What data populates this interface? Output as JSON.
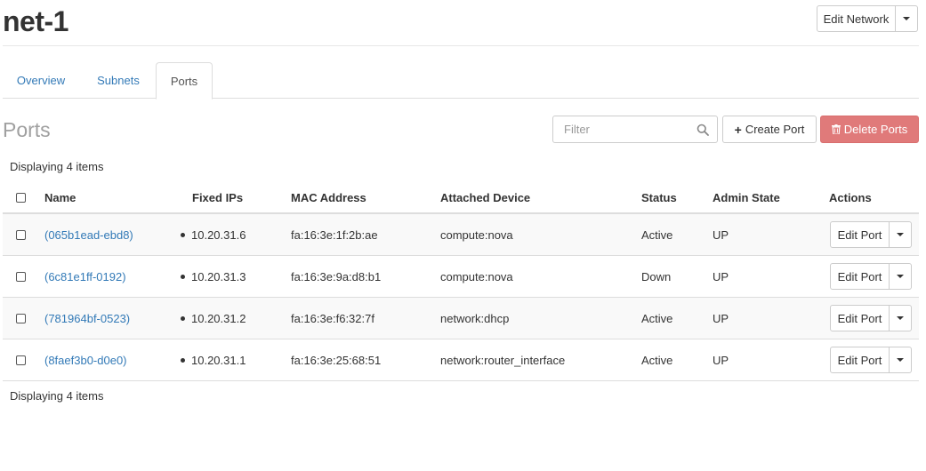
{
  "header": {
    "title": "net-1",
    "edit_network_label": "Edit Network"
  },
  "tabs": [
    {
      "label": "Overview"
    },
    {
      "label": "Subnets"
    },
    {
      "label": "Ports"
    }
  ],
  "ports_section": {
    "title": "Ports",
    "filter_placeholder": "Filter",
    "create_label": "Create Port",
    "delete_label": "Delete Ports",
    "count_text": "Displaying 4 items",
    "columns": [
      "Name",
      "Fixed IPs",
      "MAC Address",
      "Attached Device",
      "Status",
      "Admin State",
      "Actions"
    ],
    "rows": [
      {
        "name": "(065b1ead-ebd8)",
        "ip": "10.20.31.6",
        "mac": "fa:16:3e:1f:2b:ae",
        "device": "compute:nova",
        "status": "Active",
        "admin_state": "UP",
        "action": "Edit Port"
      },
      {
        "name": "(6c81e1ff-0192)",
        "ip": "10.20.31.3",
        "mac": "fa:16:3e:9a:d8:b1",
        "device": "compute:nova",
        "status": "Down",
        "admin_state": "UP",
        "action": "Edit Port"
      },
      {
        "name": "(781964bf-0523)",
        "ip": "10.20.31.2",
        "mac": "fa:16:3e:f6:32:7f",
        "device": "network:dhcp",
        "status": "Active",
        "admin_state": "UP",
        "action": "Edit Port"
      },
      {
        "name": "(8faef3b0-d0e0)",
        "ip": "10.20.31.1",
        "mac": "fa:16:3e:25:68:51",
        "device": "network:router_interface",
        "status": "Active",
        "admin_state": "UP",
        "action": "Edit Port"
      }
    ]
  },
  "colors": {
    "link": "#337ab7",
    "danger": "#e07a7a"
  },
  "icons": {
    "search": "search-icon",
    "plus": "plus-icon",
    "trash": "trash-icon",
    "caret": "chevron-down-icon"
  }
}
